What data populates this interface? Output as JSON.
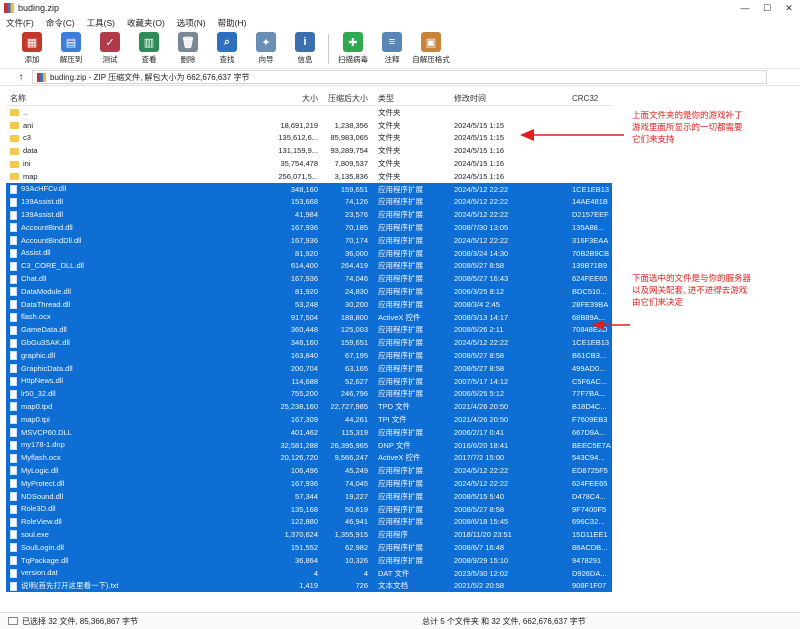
{
  "window": {
    "title": "buding.zip"
  },
  "menu": [
    "文件(F)",
    "命令(C)",
    "工具(S)",
    "收藏夹(O)",
    "选项(N)",
    "帮助(H)"
  ],
  "toolbar": [
    {
      "label": "添加",
      "icon": "add-archive-icon",
      "color": "#c0392b"
    },
    {
      "label": "解压到",
      "icon": "extract-folder-icon",
      "color": "#3b7dd8"
    },
    {
      "label": "测试",
      "icon": "test-icon",
      "color": "#b03a4a"
    },
    {
      "label": "查看",
      "icon": "view-book-icon",
      "color": "#2e8b57"
    },
    {
      "label": "删除",
      "icon": "trash-icon",
      "color": "#7a8796"
    },
    {
      "label": "查找",
      "icon": "find-magnifier-icon",
      "color": "#2f6fc0"
    },
    {
      "label": "向导",
      "icon": "wizard-icon",
      "color": "#6a8fb5"
    },
    {
      "label": "信息",
      "icon": "info-icon",
      "color": "#3b6fb0"
    },
    {
      "label": "扫描病毒",
      "icon": "virus-scan-icon",
      "color": "#2fa84f"
    },
    {
      "label": "注释",
      "icon": "comment-icon",
      "color": "#5a86b8"
    },
    {
      "label": "自解压格式",
      "icon": "sfx-icon",
      "color": "#c9843a"
    }
  ],
  "address": {
    "text": "buding.zip - ZIP 压缩文件, 解包大小为 662,676,637 字节"
  },
  "columns": {
    "name": "名称",
    "size": "大小",
    "packed": "压缩后大小",
    "type": "类型",
    "modified": "修改时间",
    "crc": "CRC32"
  },
  "rows": [
    {
      "name": "..",
      "size": "",
      "packed": "",
      "type": "文件夹",
      "modified": "",
      "crc": "",
      "kind": "folder",
      "sel": false
    },
    {
      "name": "ani",
      "size": "18,691,219",
      "packed": "1,238,356",
      "type": "文件夹",
      "modified": "2024/5/15 1:15",
      "crc": "",
      "kind": "folder",
      "sel": false
    },
    {
      "name": "c3",
      "size": "135,612,6...",
      "packed": "85,983,065",
      "type": "文件夹",
      "modified": "2024/5/15 1:15",
      "crc": "",
      "kind": "folder",
      "sel": false
    },
    {
      "name": "data",
      "size": "131,159,9...",
      "packed": "93,289,754",
      "type": "文件夹",
      "modified": "2024/5/15 1:16",
      "crc": "",
      "kind": "folder",
      "sel": false
    },
    {
      "name": "ini",
      "size": "35,754,478",
      "packed": "7,809,537",
      "type": "文件夹",
      "modified": "2024/5/15 1:16",
      "crc": "",
      "kind": "folder",
      "sel": false
    },
    {
      "name": "map",
      "size": "256,071,5...",
      "packed": "3,135,836",
      "type": "文件夹",
      "modified": "2024/5/15 1:16",
      "crc": "",
      "kind": "folder",
      "sel": false
    },
    {
      "name": "93AcHFCv.dll",
      "size": "348,160",
      "packed": "159,651",
      "type": "应用程序扩展",
      "modified": "2024/5/12 22:22",
      "crc": "1CE1EB13",
      "kind": "file",
      "sel": true
    },
    {
      "name": "139Assist.dll",
      "size": "153,668",
      "packed": "74,126",
      "type": "应用程序扩展",
      "modified": "2024/5/12 22:22",
      "crc": "14AE481B",
      "kind": "file",
      "sel": true
    },
    {
      "name": "139Assist.dll",
      "size": "41,984",
      "packed": "23,576",
      "type": "应用程序扩展",
      "modified": "2024/5/12 22:22",
      "crc": "D2157EEF",
      "kind": "file",
      "sel": true
    },
    {
      "name": "AccountBind.dll",
      "size": "167,936",
      "packed": "70,185",
      "type": "应用程序扩展",
      "modified": "2008/7/30 13:05",
      "crc": "135A88...",
      "kind": "file",
      "sel": true
    },
    {
      "name": "AccountBindDll.dll",
      "size": "167,936",
      "packed": "70,174",
      "type": "应用程序扩展",
      "modified": "2024/5/12 22:22",
      "crc": "316F3EAA",
      "kind": "file",
      "sel": true
    },
    {
      "name": "Assist.dll",
      "size": "81,920",
      "packed": "36,000",
      "type": "应用程序扩展",
      "modified": "2008/3/24 14:30",
      "crc": "70B2B9CB",
      "kind": "file",
      "sel": true
    },
    {
      "name": "C3_CORE_DLL.dll",
      "size": "614,400",
      "packed": "264,419",
      "type": "应用程序扩展",
      "modified": "2008/5/27 8:58",
      "crc": "139B71B9",
      "kind": "file",
      "sel": true
    },
    {
      "name": "Chat.dll",
      "size": "167,936",
      "packed": "74,046",
      "type": "应用程序扩展",
      "modified": "2008/5/27 16:43",
      "crc": "624FEE65",
      "kind": "file",
      "sel": true
    },
    {
      "name": "DataModule.dll",
      "size": "81,920",
      "packed": "24,830",
      "type": "应用程序扩展",
      "modified": "2006/3/25 8:12",
      "crc": "BDC510...",
      "kind": "file",
      "sel": true
    },
    {
      "name": "DataThread.dll",
      "size": "53,248",
      "packed": "30,200",
      "type": "应用程序扩展",
      "modified": "2008/3/4 2:45",
      "crc": "28FE39BA",
      "kind": "file",
      "sel": true
    },
    {
      "name": "flash.ocx",
      "size": "917,504",
      "packed": "188,800",
      "type": "ActiveX 控件",
      "modified": "2008/3/13 14:17",
      "crc": "68B89A...",
      "kind": "file",
      "sel": true
    },
    {
      "name": "GameData.dll",
      "size": "360,448",
      "packed": "125,003",
      "type": "应用程序扩展",
      "modified": "2008/5/26 2:11",
      "crc": "70848E2D",
      "kind": "file",
      "sel": true
    },
    {
      "name": "GbGu3SAK.dll",
      "size": "348,160",
      "packed": "159,651",
      "type": "应用程序扩展",
      "modified": "2024/5/12 22:22",
      "crc": "1CE1EB13",
      "kind": "file",
      "sel": true
    },
    {
      "name": "graphic.dll",
      "size": "163,840",
      "packed": "67,195",
      "type": "应用程序扩展",
      "modified": "2008/5/27 8:58",
      "crc": "B61CB3...",
      "kind": "file",
      "sel": true
    },
    {
      "name": "GraphicData.dll",
      "size": "200,704",
      "packed": "63,165",
      "type": "应用程序扩展",
      "modified": "2008/5/27 8:58",
      "crc": "499AD0...",
      "kind": "file",
      "sel": true
    },
    {
      "name": "HttpNews.dll",
      "size": "114,688",
      "packed": "52,627",
      "type": "应用程序扩展",
      "modified": "2007/5/17 14:12",
      "crc": "C5F6AC...",
      "kind": "file",
      "sel": true
    },
    {
      "name": "lr50_32.dll",
      "size": "755,200",
      "packed": "246,796",
      "type": "应用程序扩展",
      "modified": "2006/5/25 5:12",
      "crc": "77F7BA...",
      "kind": "file",
      "sel": true
    },
    {
      "name": "map0.tpd",
      "size": "25,238,160",
      "packed": "22,727,985",
      "type": "TPD 文件",
      "modified": "2021/4/26 20:50",
      "crc": "B18D4C...",
      "kind": "file",
      "sel": true
    },
    {
      "name": "map0.tpi",
      "size": "167,309",
      "packed": "44,261",
      "type": "TPI 文件",
      "modified": "2021/4/26 20:50",
      "crc": "F7609EB3",
      "kind": "file",
      "sel": true
    },
    {
      "name": "MSVCP60.DLL",
      "size": "401,462",
      "packed": "115,319",
      "type": "应用程序扩展",
      "modified": "2006/2/17 0:41",
      "crc": "667D9A...",
      "kind": "file",
      "sel": true
    },
    {
      "name": "my178-1.dnp",
      "size": "32,581,288",
      "packed": "26,395,965",
      "type": "DNP 文件",
      "modified": "2016/6/20 18:41",
      "crc": "BEEC5E7A",
      "kind": "file",
      "sel": true
    },
    {
      "name": "Myflash.ocx",
      "size": "20,126,720",
      "packed": "9,566,247",
      "type": "ActiveX 控件",
      "modified": "2017/7/2 15:00",
      "crc": "543C94...",
      "kind": "file",
      "sel": true
    },
    {
      "name": "MyLogic.dll",
      "size": "106,496",
      "packed": "45,249",
      "type": "应用程序扩展",
      "modified": "2024/5/12 22:22",
      "crc": "ED8725F5",
      "kind": "file",
      "sel": true
    },
    {
      "name": "MyProtect.dll",
      "size": "167,936",
      "packed": "74,045",
      "type": "应用程序扩展",
      "modified": "2024/5/12 22:22",
      "crc": "624FEE65",
      "kind": "file",
      "sel": true
    },
    {
      "name": "NDSound.dll",
      "size": "57,344",
      "packed": "19,227",
      "type": "应用程序扩展",
      "modified": "2008/5/15 5:40",
      "crc": "D478C4...",
      "kind": "file",
      "sel": true
    },
    {
      "name": "Role3D.dll",
      "size": "135,168",
      "packed": "50,619",
      "type": "应用程序扩展",
      "modified": "2008/5/27 8:58",
      "crc": "9F7400F5",
      "kind": "file",
      "sel": true
    },
    {
      "name": "RoleView.dll",
      "size": "122,880",
      "packed": "46,941",
      "type": "应用程序扩展",
      "modified": "2008/6/18 15:45",
      "crc": "696C32...",
      "kind": "file",
      "sel": true
    },
    {
      "name": "soul.exe",
      "size": "1,370,624",
      "packed": "1,355,915",
      "type": "应用程序",
      "modified": "2018/11/20 23:51",
      "crc": "15D11EE1",
      "kind": "file",
      "sel": true
    },
    {
      "name": "SoulLogin.dll",
      "size": "151,552",
      "packed": "62,982",
      "type": "应用程序扩展",
      "modified": "2008/6/7 16:48",
      "crc": "88ACDB...",
      "kind": "file",
      "sel": true
    },
    {
      "name": "TqPackage.dll",
      "size": "36,864",
      "packed": "10,326",
      "type": "应用程序扩展",
      "modified": "2008/9/29 15:10",
      "crc": "9478291",
      "kind": "file",
      "sel": true
    },
    {
      "name": "version.dat",
      "size": "4",
      "packed": "4",
      "type": "DAT 文件",
      "modified": "2023/5/30 12:02",
      "crc": "D926DA...",
      "kind": "file",
      "sel": true
    },
    {
      "name": "说明(首先打开这里看一下).txt",
      "size": "1,419",
      "packed": "726",
      "type": "文本文档",
      "modified": "2021/5/2 20:58",
      "crc": "908F1F07",
      "kind": "file",
      "sel": true
    }
  ],
  "status": {
    "left": "已选择 32 文件, 85,366,867 字节",
    "right": "总计 5 个文件夹 和 32 文件, 662,676,637 字节"
  },
  "annotations": {
    "top": "上面文件夹的是你的游戏补丁\n游戏里面所显示的一切都需要\n它们来支持",
    "bottom": "下面选中的文件是与你的服务器\n以及网关配套, 进不进得去游戏\n由它们来决定"
  },
  "colors": {
    "selection": "#0f6ed3",
    "annotation": "#e0201c"
  }
}
